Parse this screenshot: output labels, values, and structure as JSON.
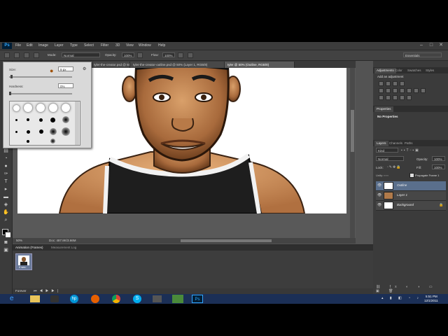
{
  "menubar": {
    "logo": "Ps",
    "items": [
      "File",
      "Edit",
      "Image",
      "Layer",
      "Type",
      "Select",
      "Filter",
      "3D",
      "View",
      "Window",
      "Help"
    ]
  },
  "options": {
    "mode_label": "Mode:",
    "mode_value": "Normal",
    "opacity_label": "Opacity:",
    "opacity_value": "100%",
    "flow_label": "Flow:",
    "flow_value": "100%",
    "workspace": "Essentials"
  },
  "tabs": [
    {
      "label": "tyler-the-creator.psd @ 50% (Outline, RGB/8)",
      "active": false
    },
    {
      "label": "tyler-the-creator-outline.psd @ 50% (Layer 1, RGB/8)",
      "active": false
    },
    {
      "label": "tyler @ 50% (Outline, RGB/8)",
      "active": true
    }
  ],
  "brush_panel": {
    "size_label": "Size:",
    "size_value": "9 px",
    "hardness_label": "Hardness:",
    "hardness_value": "0%"
  },
  "status": {
    "zoom": "50%",
    "doc": "Doc: 487.8K/3.66M"
  },
  "right_panel": {
    "top_tabs": [
      "Adjustments",
      "Color",
      "Swatches",
      "Styles"
    ],
    "adjust_title": "Add an adjustment",
    "props_title": "Properties",
    "props_empty": "No Properties",
    "layer_tabs": [
      "Layers",
      "Channels",
      "Paths"
    ],
    "kind_label": "Kind",
    "blend_mode": "Normal",
    "opacity_label": "Opacity:",
    "opacity_value": "100%",
    "lock_label": "Lock:",
    "fill_label": "Fill:",
    "fill_value": "100%",
    "propagate_label": "Propagate Frame 1",
    "layers": [
      {
        "name": "Outline",
        "selected": true
      },
      {
        "name": "Layer 1",
        "selected": false
      },
      {
        "name": "Background",
        "selected": false
      }
    ]
  },
  "animation": {
    "tabs": [
      "Animation (Frames)",
      "Measurement Log"
    ],
    "frame_time": "0 sec.",
    "loop": "Forever"
  },
  "taskbar": {
    "time": "5:51 PM",
    "date": "12/1/2011",
    "apps": [
      "ie-icon",
      "explorer-icon",
      "media-icon",
      "hp-icon",
      "firefox-icon",
      "chrome-icon",
      "skype-icon",
      "app-icon",
      "app2-icon",
      "photoshop-icon"
    ]
  },
  "colors": {
    "accent": "#31a8ff",
    "selected_layer": "#5a6f8c",
    "taskbar": "#1b2f56"
  }
}
